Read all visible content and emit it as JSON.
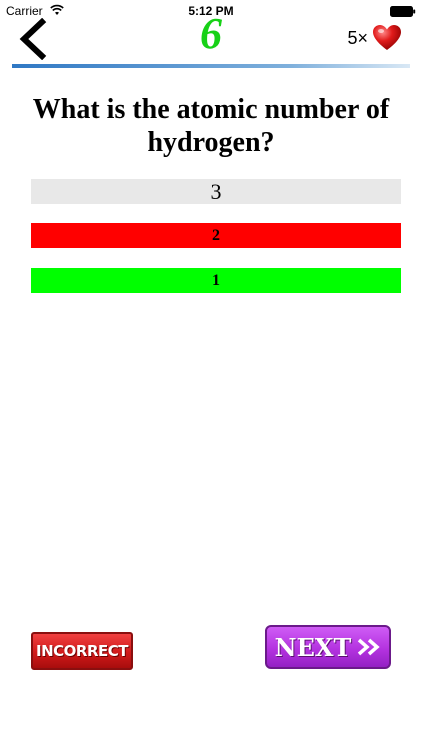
{
  "status_bar": {
    "carrier": "Carrier",
    "time": "5:12 PM",
    "wifi_icon": "wifi-icon",
    "battery_icon": "battery-icon"
  },
  "header": {
    "back_icon": "chevron-left-icon",
    "score": "6",
    "score_color": "#17d117",
    "lives": "5×",
    "heart_icon": "heart-icon",
    "progress_line_color": "#2f78c4"
  },
  "question": {
    "text": "What is the atomic number of hydrogen?"
  },
  "answers": [
    {
      "label": "3",
      "state": "neutral",
      "color": "#e8e8e8"
    },
    {
      "label": "2",
      "state": "wrong",
      "color": "#ff0000"
    },
    {
      "label": "1",
      "state": "correct",
      "color": "#00ff00"
    }
  ],
  "feedback": {
    "result_label": "INCORRECT",
    "result_color": "#e02020",
    "next_label": "NEXT",
    "next_color": "#b433e0",
    "next_icon": "double-chevron-right-icon"
  }
}
